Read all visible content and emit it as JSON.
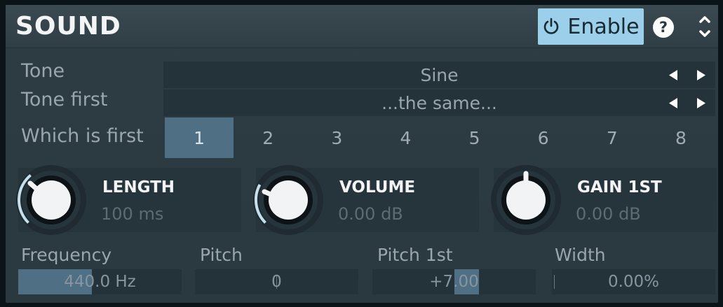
{
  "header": {
    "title": "SOUND",
    "enable_label": "Enable",
    "help_glyph": "?",
    "accent": "#9ccfea"
  },
  "rows": {
    "tone": {
      "label": "Tone",
      "value": "Sine"
    },
    "tone_first": {
      "label": "Tone first",
      "value": "...the same..."
    }
  },
  "which_is_first": {
    "label": "Which is first",
    "options": [
      "1",
      "2",
      "3",
      "4",
      "5",
      "6",
      "7",
      "8"
    ],
    "selected": "1"
  },
  "knobs": [
    {
      "name": "LENGTH",
      "value": "100 ms"
    },
    {
      "name": "VOLUME",
      "value": "0.00 dB"
    },
    {
      "name": "GAIN 1ST",
      "value": "0.00 dB"
    }
  ],
  "sliders": [
    {
      "label": "Frequency",
      "value": "440.0 Hz",
      "fill_fraction": 0.45
    },
    {
      "label": "Pitch",
      "value": "0"
    },
    {
      "label": "Pitch 1st",
      "value": "+7.00",
      "fill_fraction": 0.15
    },
    {
      "label": "Width",
      "value": "0.00%"
    }
  ],
  "icons": {
    "enable": "power-icon",
    "help": "help-icon",
    "collapse": "expand-collapse-icon",
    "prev": "arrow-left-icon",
    "next": "arrow-right-icon"
  }
}
